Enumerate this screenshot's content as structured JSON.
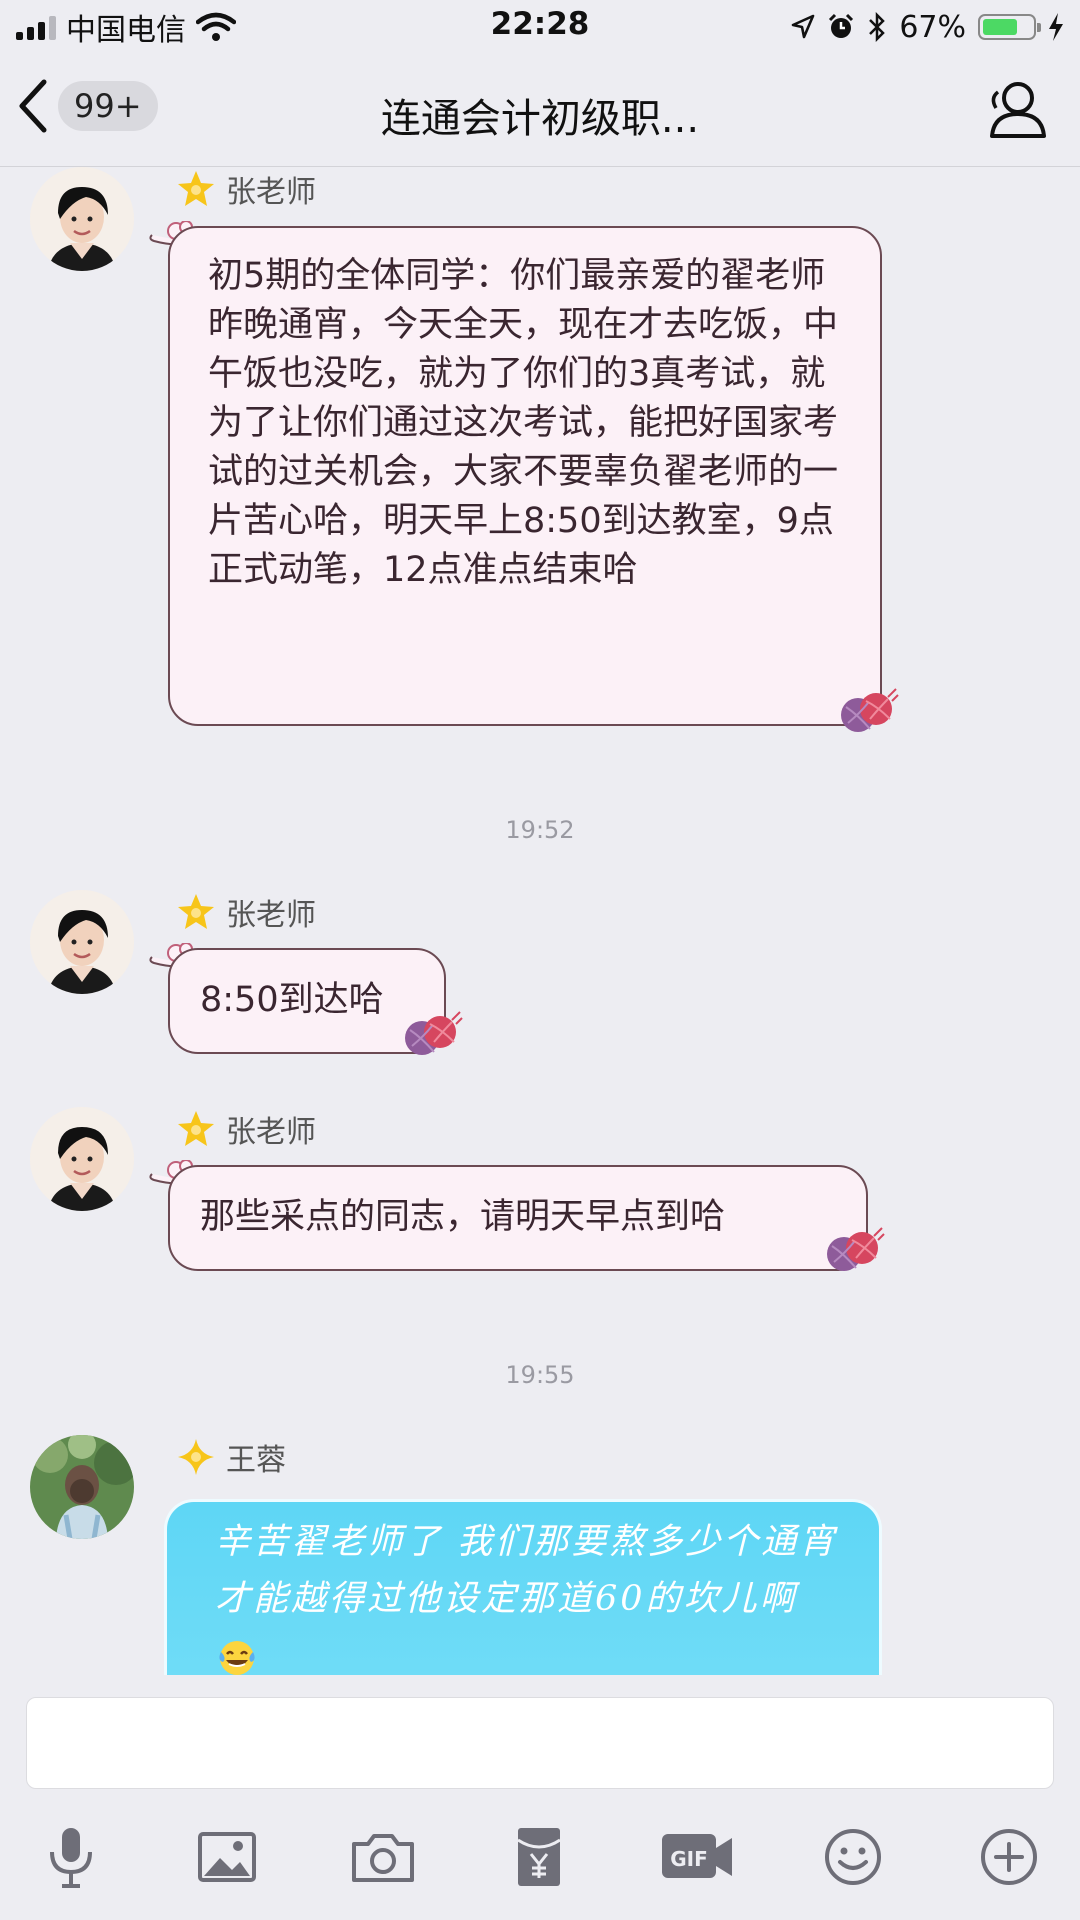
{
  "status": {
    "carrier": "中国电信",
    "time": "22:28",
    "battery": "67%"
  },
  "nav": {
    "unread": "99+",
    "title": "连通会计初级职..."
  },
  "messages": [
    {
      "sender": "张老师",
      "text": "初5期的全体同学：你们最亲爱的翟老师昨晚通宵，今天全天，现在才去吃饭，中午饭也没吃，就为了你们的3真考试，就为了让你们通过这次考试，能把好国家考试的过关机会，大家不要辜负翟老师的一片苦心哈，明天早上8:50到达教室，9点正式动笔，12点准点结束哈"
    },
    {
      "timestamp": "19:52"
    },
    {
      "sender": "张老师",
      "text": "8:50到达哈"
    },
    {
      "sender": "张老师",
      "text": "那些采点的同志，请明天早点到哈"
    },
    {
      "timestamp": "19:55"
    },
    {
      "sender": "王蓉",
      "text": "辛苦翟老师了  我们那要熬多少个通宵才能越得过他设定那道60的坎儿啊"
    }
  ],
  "toolbar": {
    "icons": [
      "microphone-icon",
      "image-icon",
      "camera-icon",
      "red-packet-icon",
      "gif-icon",
      "emoji-icon",
      "plus-icon"
    ]
  }
}
